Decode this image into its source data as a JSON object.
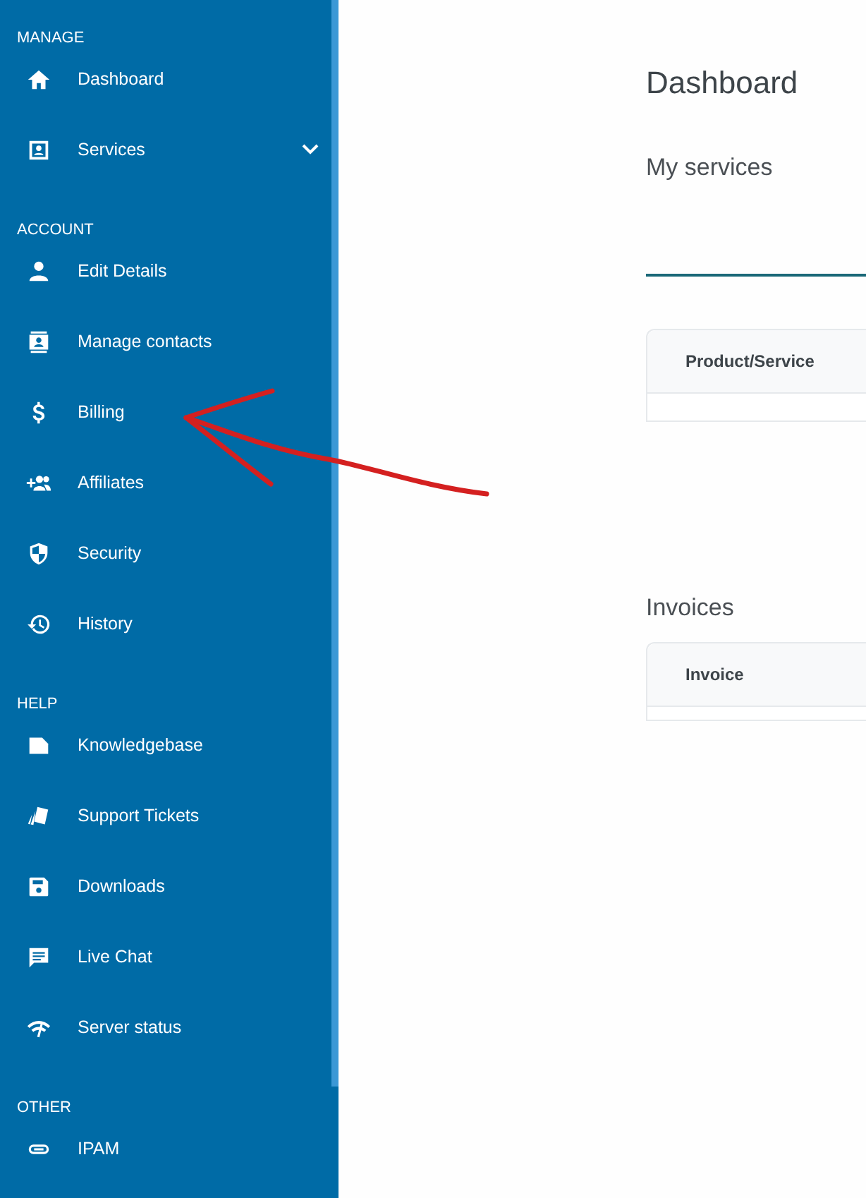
{
  "sidebar": {
    "sections": [
      {
        "title": "MANAGE",
        "items": [
          {
            "label": "Dashboard",
            "expandable": false
          },
          {
            "label": "Services",
            "expandable": true
          }
        ]
      },
      {
        "title": "ACCOUNT",
        "items": [
          {
            "label": "Edit Details",
            "expandable": false
          },
          {
            "label": "Manage contacts",
            "expandable": false
          },
          {
            "label": "Billing",
            "expandable": false
          },
          {
            "label": "Affiliates",
            "expandable": false
          },
          {
            "label": "Security",
            "expandable": false
          },
          {
            "label": "History",
            "expandable": false
          }
        ]
      },
      {
        "title": "HELP",
        "items": [
          {
            "label": "Knowledgebase",
            "expandable": false
          },
          {
            "label": "Support Tickets",
            "expandable": false
          },
          {
            "label": "Downloads",
            "expandable": false
          },
          {
            "label": "Live Chat",
            "expandable": false
          },
          {
            "label": "Server status",
            "expandable": false
          }
        ]
      },
      {
        "title": "OTHER",
        "items": [
          {
            "label": "IPAM",
            "expandable": false
          }
        ]
      }
    ]
  },
  "main": {
    "title": "Dashboard",
    "sections": [
      {
        "title": "My services",
        "underline": true,
        "columns": [
          "Product/Service"
        ]
      },
      {
        "title": "Invoices",
        "underline": false,
        "columns": [
          "Invoice"
        ]
      }
    ]
  }
}
